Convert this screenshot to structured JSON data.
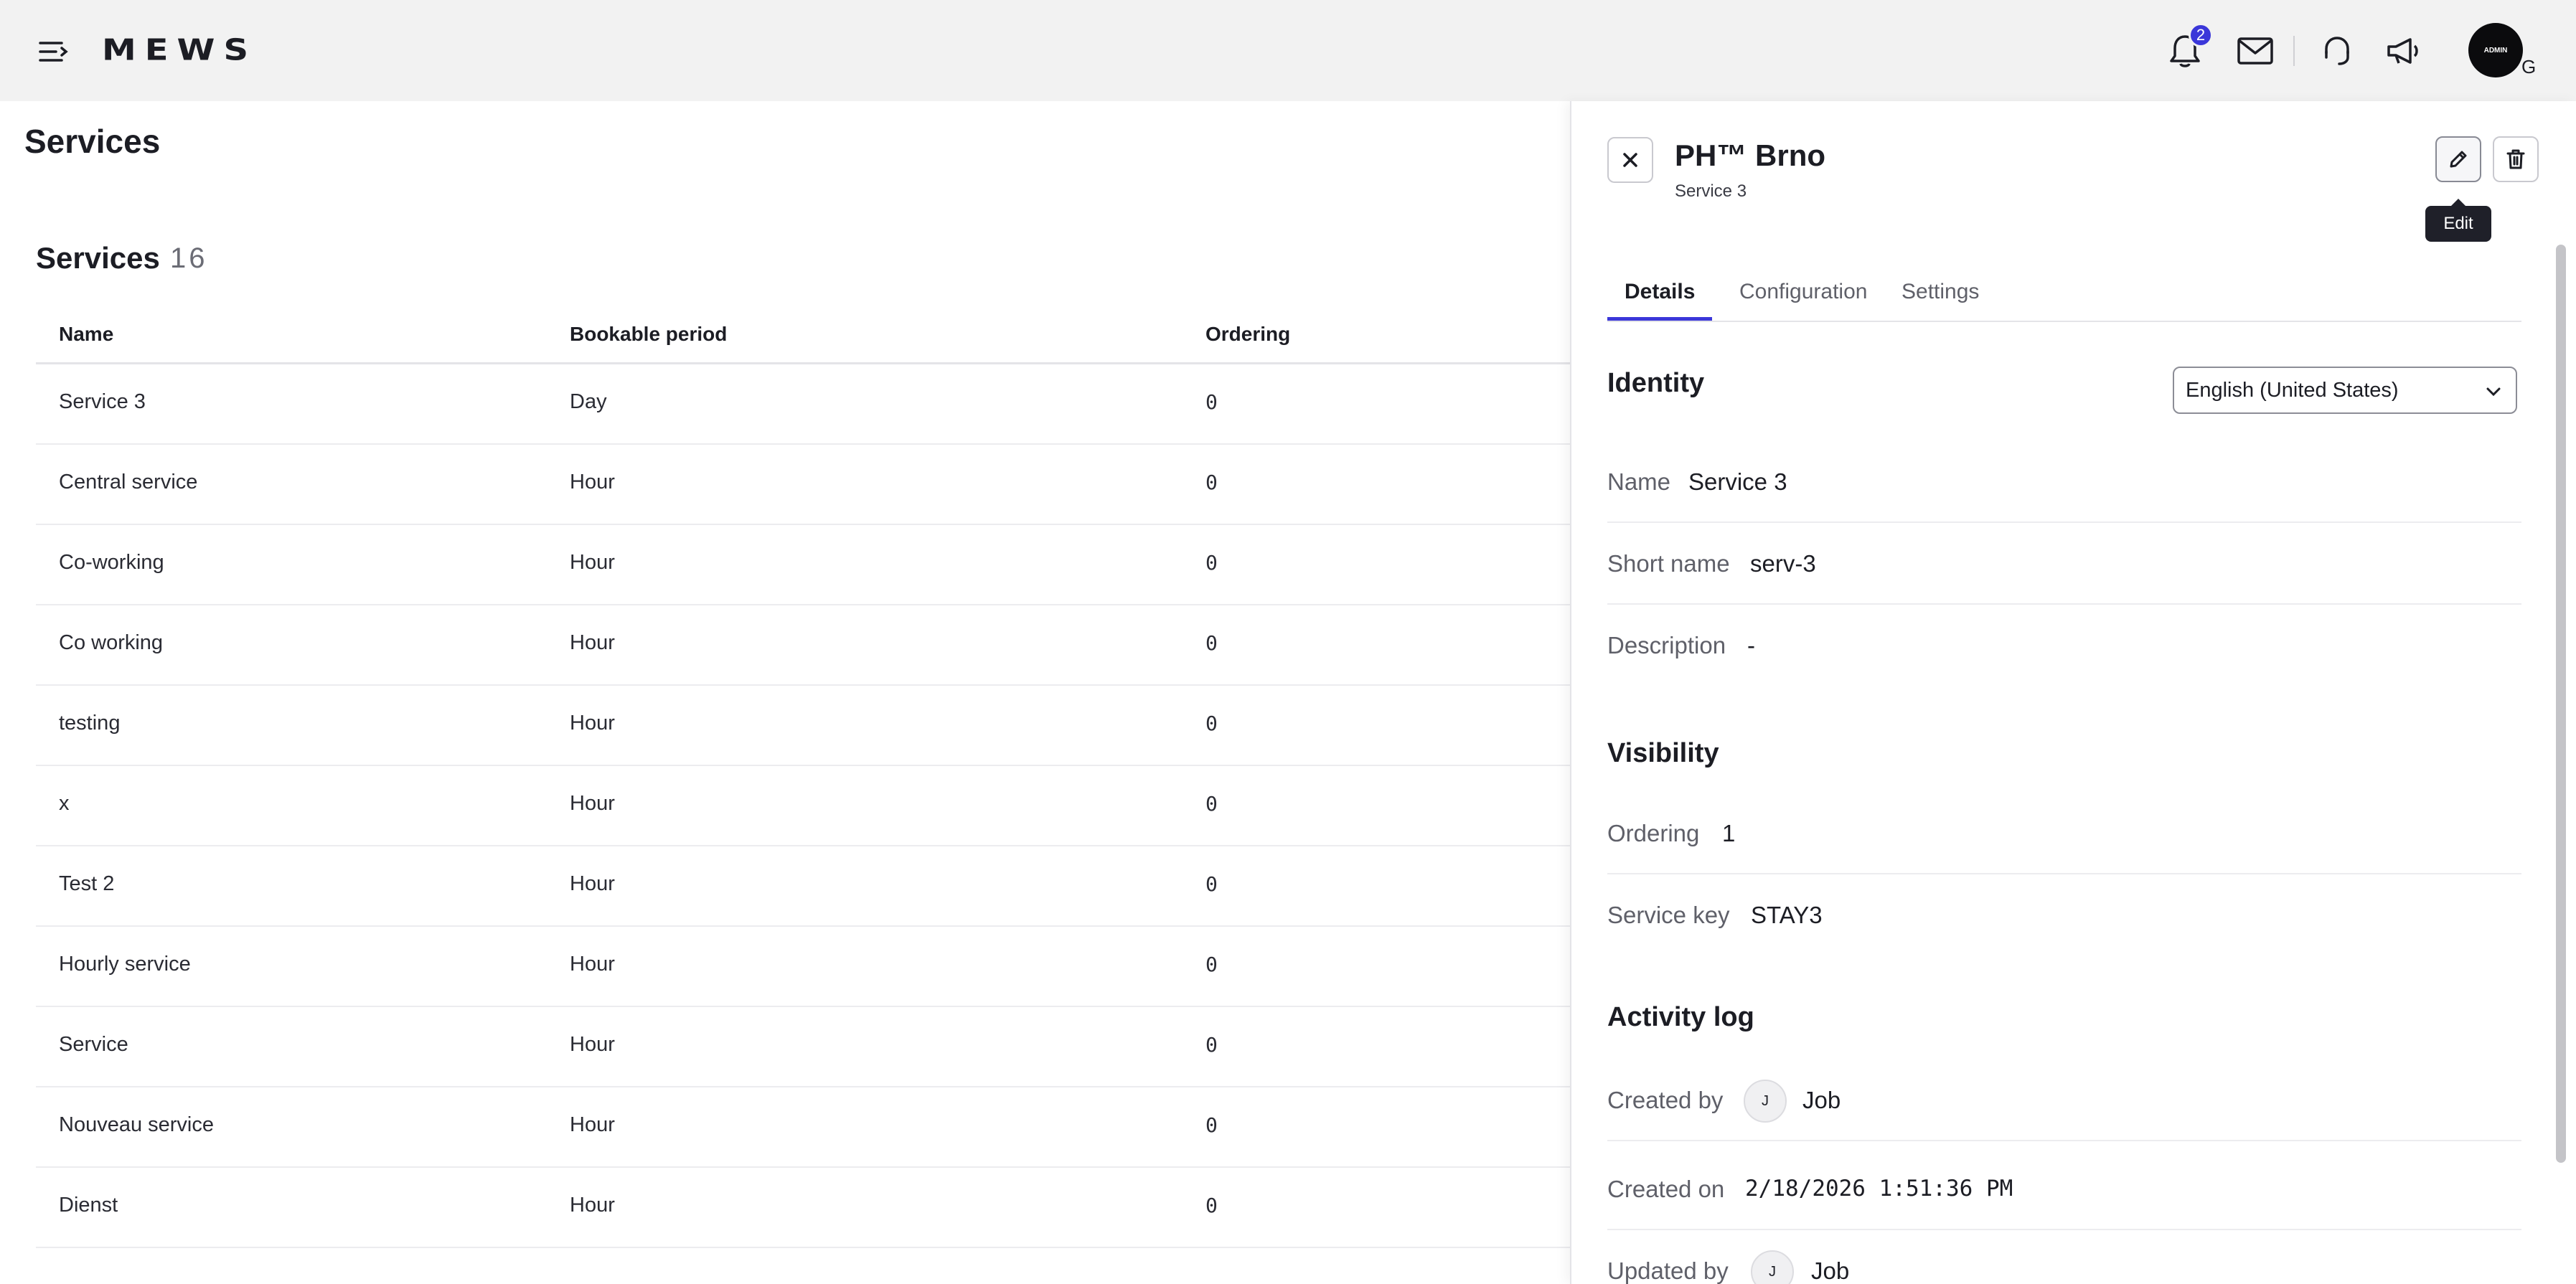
{
  "header": {
    "logo": "MEWS",
    "notification_count": "2",
    "avatar_label": "ADMIN",
    "avatar_suffix": "G"
  },
  "page": {
    "title": "Services",
    "section_title": "Services",
    "section_count": "16"
  },
  "table": {
    "columns": [
      "Name",
      "Bookable period",
      "Ordering"
    ],
    "rows": [
      {
        "name": "Service 3",
        "period": "Day",
        "ordering": "0"
      },
      {
        "name": "Central service",
        "period": "Hour",
        "ordering": "0"
      },
      {
        "name": "Co-working",
        "period": "Hour",
        "ordering": "0"
      },
      {
        "name": "Co working",
        "period": "Hour",
        "ordering": "0"
      },
      {
        "name": "testing",
        "period": "Hour",
        "ordering": "0"
      },
      {
        "name": "x",
        "period": "Hour",
        "ordering": "0"
      },
      {
        "name": "Test 2",
        "period": "Hour",
        "ordering": "0"
      },
      {
        "name": "Hourly service",
        "period": "Hour",
        "ordering": "0"
      },
      {
        "name": "Service",
        "period": "Hour",
        "ordering": "0"
      },
      {
        "name": "Nouveau service",
        "period": "Hour",
        "ordering": "0"
      },
      {
        "name": "Dienst",
        "period": "Hour",
        "ordering": "0"
      }
    ]
  },
  "panel": {
    "title": "PH™ Brno",
    "subtitle": "Service 3",
    "edit_tooltip": "Edit",
    "tabs": [
      "Details",
      "Configuration",
      "Settings"
    ],
    "identity": {
      "heading": "Identity",
      "language": "English (United States)",
      "name_label": "Name",
      "name_value": "Service 3",
      "short_name_label": "Short name",
      "short_name_value": "serv-3",
      "description_label": "Description",
      "description_value": "-"
    },
    "visibility": {
      "heading": "Visibility",
      "ordering_label": "Ordering",
      "ordering_value": "1",
      "service_key_label": "Service key",
      "service_key_value": "STAY3"
    },
    "activity": {
      "heading": "Activity log",
      "created_by_label": "Created by",
      "created_by_initial": "J",
      "created_by_value": "Job",
      "created_on_label": "Created on",
      "created_on_value": "2/18/2026 1:51:36 PM",
      "updated_by_label": "Updated by",
      "updated_by_initial": "J",
      "updated_by_value": "Job"
    }
  },
  "colors": {
    "accent": "#3b37d9",
    "topbar": "#f2f2f2"
  }
}
